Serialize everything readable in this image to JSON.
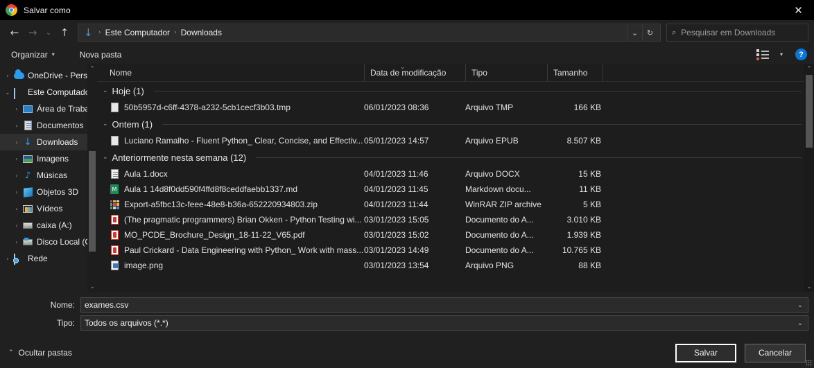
{
  "window": {
    "title": "Salvar como",
    "app_icon": "chrome-logo-icon",
    "close_label": "✕"
  },
  "nav": {
    "back": "←",
    "forward": "→",
    "recent": "⌄",
    "up": "↑",
    "breadcrumb_icon": "download-folder-icon",
    "breadcrumb": [
      "Este Computador",
      "Downloads"
    ],
    "separator": "›",
    "dropdown": "⌄",
    "refresh": "↻"
  },
  "search": {
    "icon": "search-icon",
    "placeholder": "Pesquisar em Downloads",
    "value": ""
  },
  "toolbar": {
    "organize_label": "Organizar",
    "organize_caret": "▾",
    "new_folder_label": "Nova pasta",
    "view_icon": "view-mode-icon",
    "view_caret": "▾",
    "help_label": "?"
  },
  "sidebar": {
    "items": [
      {
        "label": "OneDrive - Personal",
        "icon": "cloud-icon",
        "expander": "›",
        "indent": false,
        "selected": false,
        "expanded": false
      },
      {
        "label": "Este Computador",
        "icon": "computer-icon",
        "expander": "⌄",
        "indent": false,
        "selected": false,
        "expanded": true
      },
      {
        "label": "Área de Trabalho",
        "icon": "desktop-icon",
        "expander": "›",
        "indent": true,
        "selected": false,
        "expanded": false
      },
      {
        "label": "Documentos",
        "icon": "documents-icon",
        "expander": "›",
        "indent": true,
        "selected": false,
        "expanded": false
      },
      {
        "label": "Downloads",
        "icon": "download-icon",
        "expander": "›",
        "indent": true,
        "selected": true,
        "expanded": false
      },
      {
        "label": "Imagens",
        "icon": "pictures-icon",
        "expander": "›",
        "indent": true,
        "selected": false,
        "expanded": false
      },
      {
        "label": "Músicas",
        "icon": "music-icon",
        "expander": "›",
        "indent": true,
        "selected": false,
        "expanded": false
      },
      {
        "label": "Objetos 3D",
        "icon": "objects3d-icon",
        "expander": "›",
        "indent": true,
        "selected": false,
        "expanded": false
      },
      {
        "label": "Vídeos",
        "icon": "videos-icon",
        "expander": "›",
        "indent": true,
        "selected": false,
        "expanded": false
      },
      {
        "label": "caixa (A:)",
        "icon": "drive-icon",
        "expander": "›",
        "indent": true,
        "selected": false,
        "expanded": false
      },
      {
        "label": "Disco Local (C:)",
        "icon": "local-disk-icon",
        "expander": "›",
        "indent": true,
        "selected": false,
        "expanded": false
      },
      {
        "label": "Rede",
        "icon": "network-icon",
        "expander": "›",
        "indent": false,
        "selected": false,
        "expanded": false
      }
    ],
    "scroll_up": "⌃",
    "scroll_down": "⌄"
  },
  "filelist": {
    "columns": [
      {
        "label": "Nome"
      },
      {
        "label": "Data de modificação"
      },
      {
        "label": "Tipo"
      },
      {
        "label": "Tamanho"
      }
    ],
    "sort_indicator": "⌄",
    "groups": [
      {
        "label": "Hoje (1)",
        "caret": "⌄",
        "files": [
          {
            "name": "50b5957d-c6ff-4378-a232-5cb1cecf3b03.tmp",
            "date": "06/01/2023 08:36",
            "type": "Arquivo TMP",
            "size": "166 KB",
            "icon": "tmp-file-icon"
          }
        ]
      },
      {
        "label": "Ontem (1)",
        "caret": "⌄",
        "files": [
          {
            "name": "Luciano Ramalho - Fluent Python_ Clear, Concise, and Effectiv...",
            "date": "05/01/2023 14:57",
            "type": "Arquivo EPUB",
            "size": "8.507 KB",
            "icon": "epub-file-icon"
          }
        ]
      },
      {
        "label": "Anteriormente nesta semana (12)",
        "caret": "⌄",
        "files": [
          {
            "name": "Aula 1.docx",
            "date": "04/01/2023 11:46",
            "type": "Arquivo DOCX",
            "size": "15 KB",
            "icon": "docx-file-icon"
          },
          {
            "name": "Aula 1 14d8f0dd590f4ffd8f8ceddfaebb1337.md",
            "date": "04/01/2023 11:45",
            "type": "Markdown docu...",
            "size": "11 KB",
            "icon": "markdown-file-icon"
          },
          {
            "name": "Export-a5fbc13c-feee-48e8-b36a-652220934803.zip",
            "date": "04/01/2023 11:44",
            "type": "WinRAR ZIP archive",
            "size": "5 KB",
            "icon": "zip-file-icon"
          },
          {
            "name": "(The pragmatic programmers) Brian Okken - Python Testing wi...",
            "date": "03/01/2023 15:05",
            "type": "Documento do A...",
            "size": "3.010 KB",
            "icon": "pdf-file-icon"
          },
          {
            "name": "MO_PCDE_Brochure_Design_18-11-22_V65.pdf",
            "date": "03/01/2023 15:02",
            "type": "Documento do A...",
            "size": "1.939 KB",
            "icon": "pdf-file-icon"
          },
          {
            "name": "Paul Crickard - Data Engineering with Python_ Work with mass...",
            "date": "03/01/2023 14:49",
            "type": "Documento do A...",
            "size": "10.765 KB",
            "icon": "pdf-file-icon"
          },
          {
            "name": "image.png",
            "date": "03/01/2023 13:54",
            "type": "Arquivo PNG",
            "size": "88 KB",
            "icon": "png-file-icon"
          }
        ]
      }
    ],
    "scroll_up": "⌃",
    "scroll_down": "⌄"
  },
  "form": {
    "name_label": "Nome:",
    "name_value": "exames.csv",
    "type_label": "Tipo:",
    "type_value": "Todos os arquivos (*.*)",
    "chevron": "⌄"
  },
  "footer": {
    "hide_folders_label": "Ocultar pastas",
    "hide_folders_caret": "⌃",
    "save_label": "Salvar",
    "cancel_label": "Cancelar"
  },
  "colors": {
    "accent": "#2f9bf0",
    "help_blue": "#0a76d8",
    "selection": "#2f2f2f",
    "pdf_red": "#d9352a",
    "md_green": "#1c8a5a"
  }
}
